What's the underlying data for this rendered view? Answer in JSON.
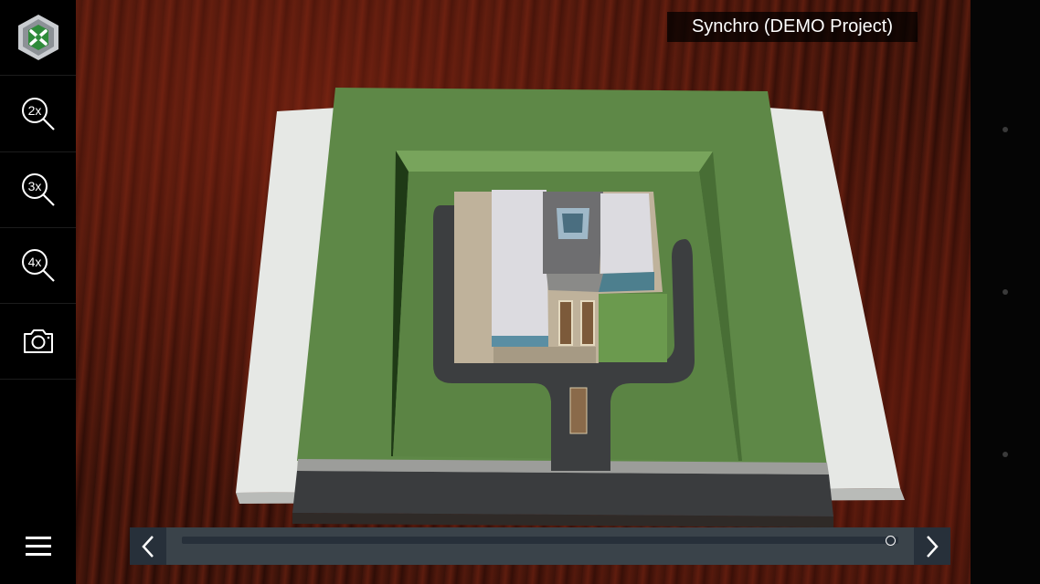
{
  "app": {
    "project_title": "Synchro (DEMO Project)",
    "logo_icon": "synchro-logo-icon"
  },
  "toolbar": {
    "items": [
      {
        "name": "zoom-2x-button",
        "icon": "zoom-in-icon",
        "label": "2x"
      },
      {
        "name": "zoom-3x-button",
        "icon": "zoom-in-icon",
        "label": "3x"
      },
      {
        "name": "zoom-4x-button",
        "icon": "zoom-in-icon",
        "label": "4x"
      },
      {
        "name": "screenshot-button",
        "icon": "camera-icon"
      }
    ],
    "menu_icon": "hamburger-menu-icon"
  },
  "timeline": {
    "prev_icon": "chevron-left-icon",
    "next_icon": "chevron-right-icon",
    "progress": 0.99
  },
  "colors": {
    "toolbar_bg": "#000000",
    "timeline_bg": "#3a434a",
    "grass": "#5f8a48",
    "road": "#3b3d3f"
  }
}
